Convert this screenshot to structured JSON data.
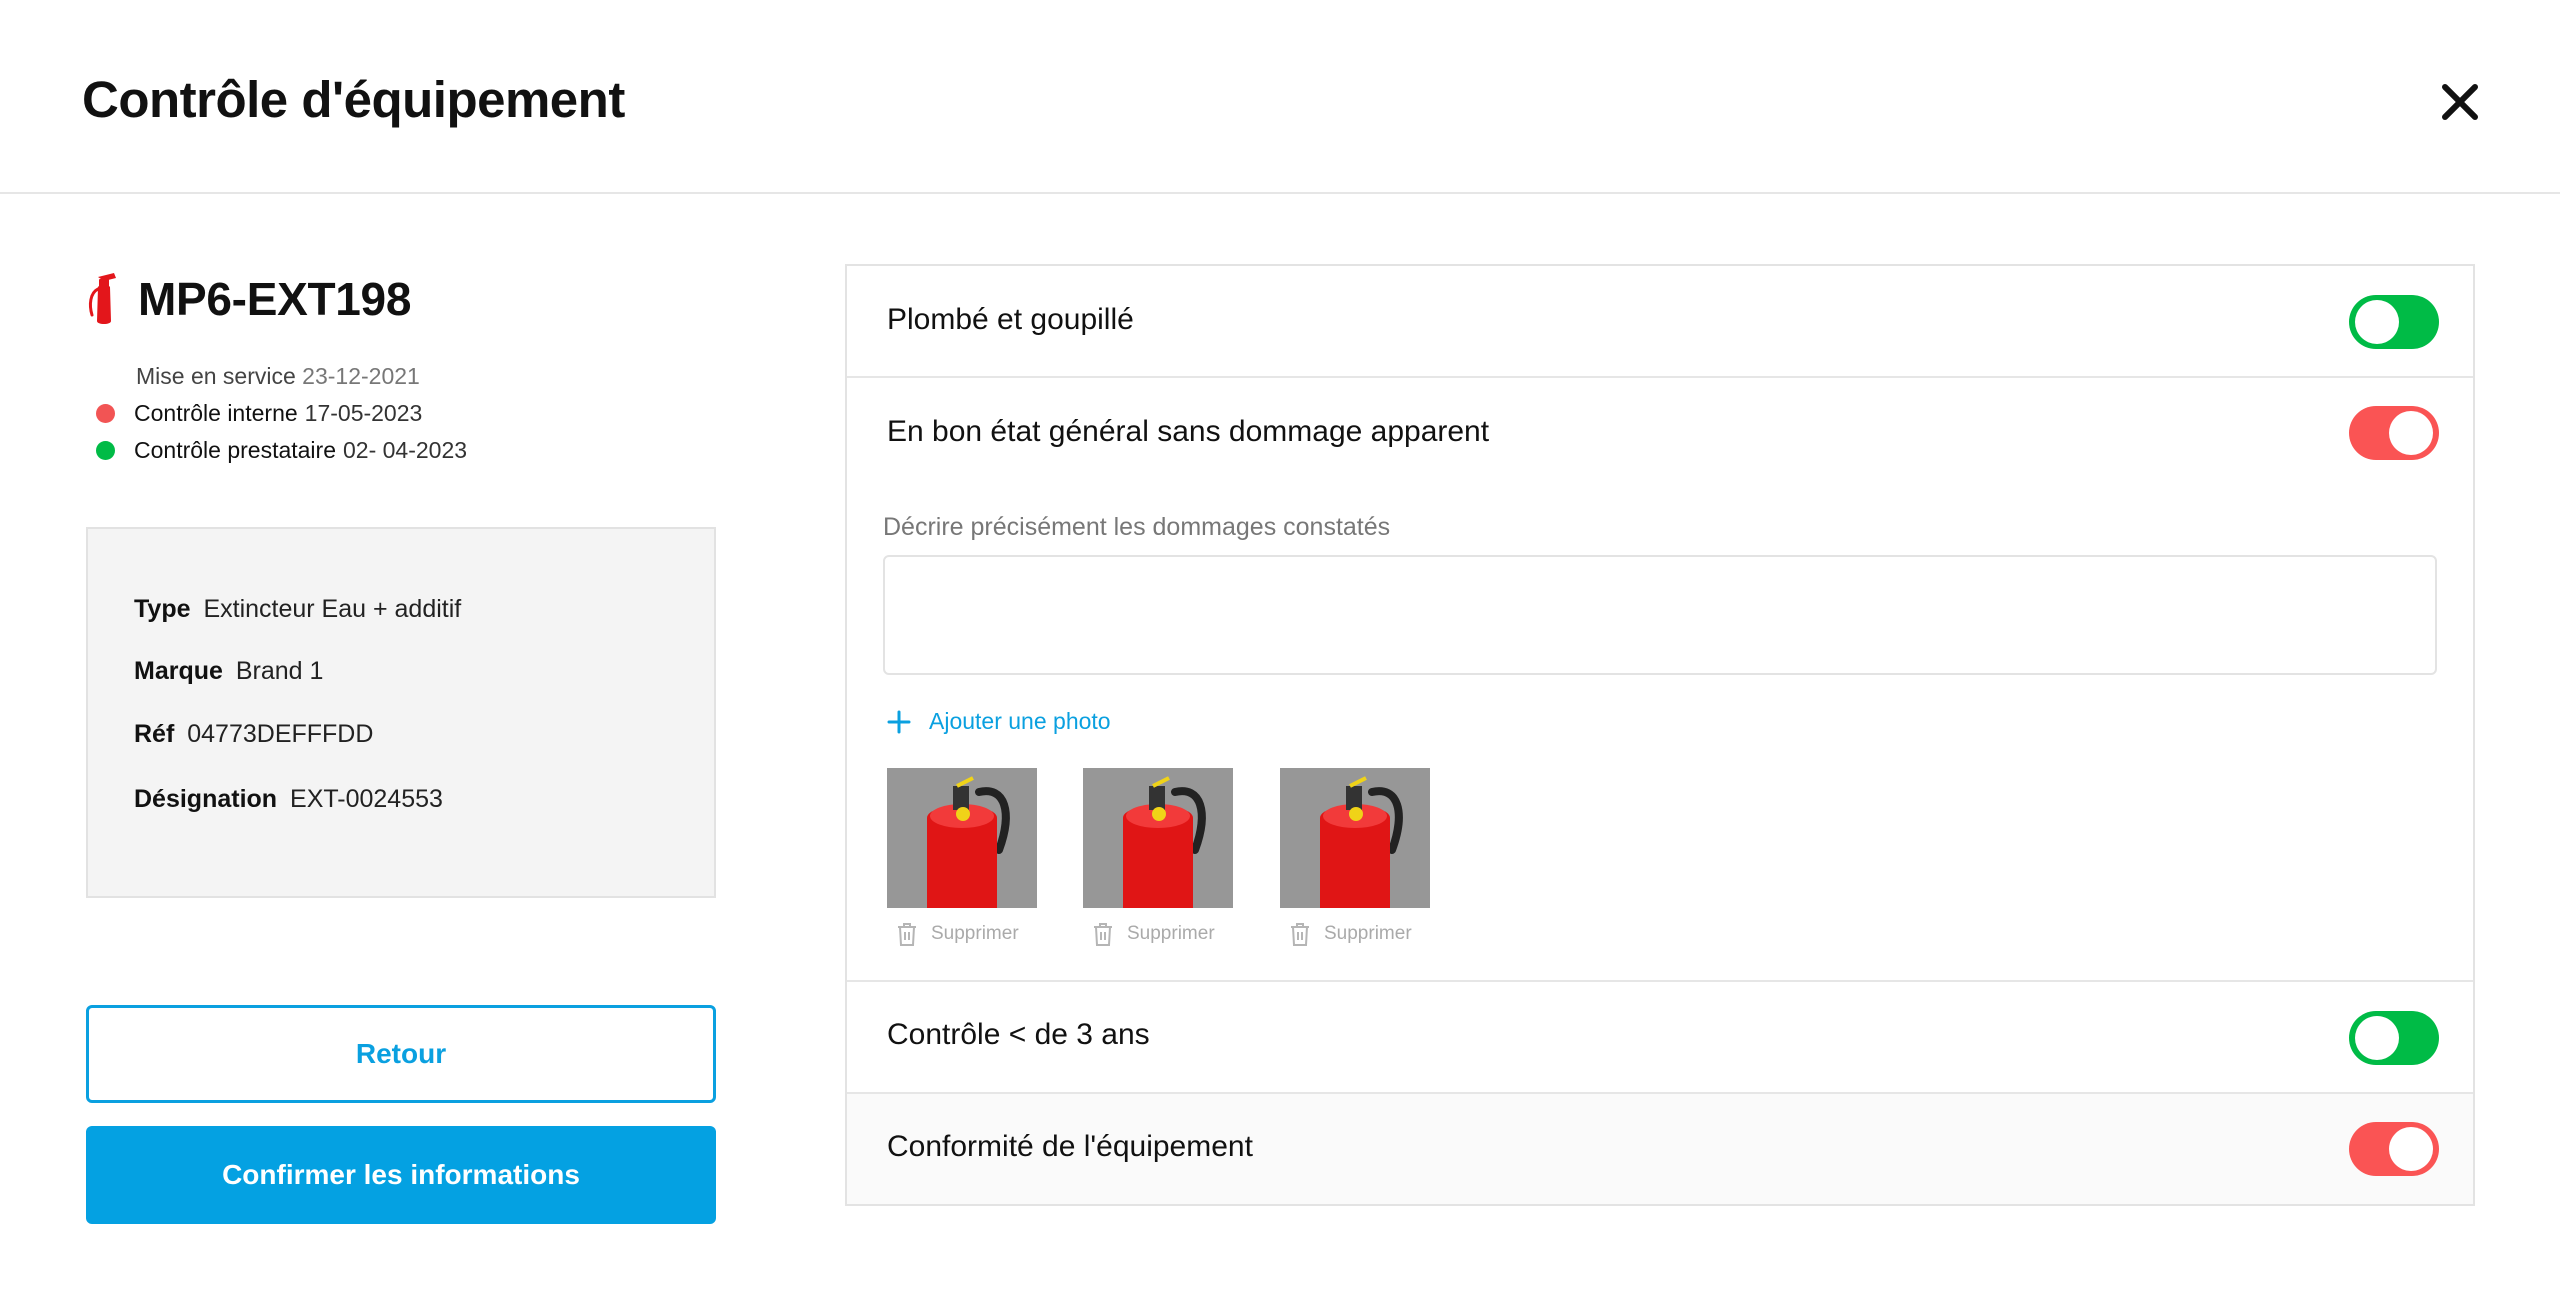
{
  "header": {
    "title": "Contrôle d'équipement",
    "close_icon": "close-icon"
  },
  "equipment": {
    "id": "MP6-EXT198",
    "icon": "fire-extinguisher-icon",
    "service_label": "Mise en service",
    "service_date": "23-12-2021",
    "controls": [
      {
        "label": "Contrôle interne",
        "date": "17-05-2023",
        "status_color": "#f25454"
      },
      {
        "label": "Contrôle prestataire",
        "date": "02- 04-2023",
        "status_color": "#00bb46"
      }
    ]
  },
  "details": {
    "type_label": "Type",
    "type_value": "Extincteur Eau + additif",
    "brand_label": "Marque",
    "brand_value": "Brand 1",
    "ref_label": "Réf",
    "ref_value": "04773DEFFFDD",
    "designation_label": "Désignation",
    "designation_value": "EXT-0024553"
  },
  "actions": {
    "back_label": "Retour",
    "confirm_label": "Confirmer les informations"
  },
  "checklist": [
    {
      "label": "Plombé et goupillé",
      "checked": true
    },
    {
      "label": "En bon état général sans dommage apparent",
      "checked": false
    },
    {
      "label": "Contrôle < de 3 ans",
      "checked": true
    },
    {
      "label": "Conformité de l'équipement",
      "checked": false
    }
  ],
  "damage": {
    "description_label": "Décrire précisément les dommages constatés",
    "description_value": "",
    "add_photo_label": "Ajouter une photo",
    "delete_label": "Supprimer",
    "photo_count": 3
  },
  "colors": {
    "accent": "#04a1e2",
    "on": "#00bb46",
    "off": "#fa5454"
  }
}
